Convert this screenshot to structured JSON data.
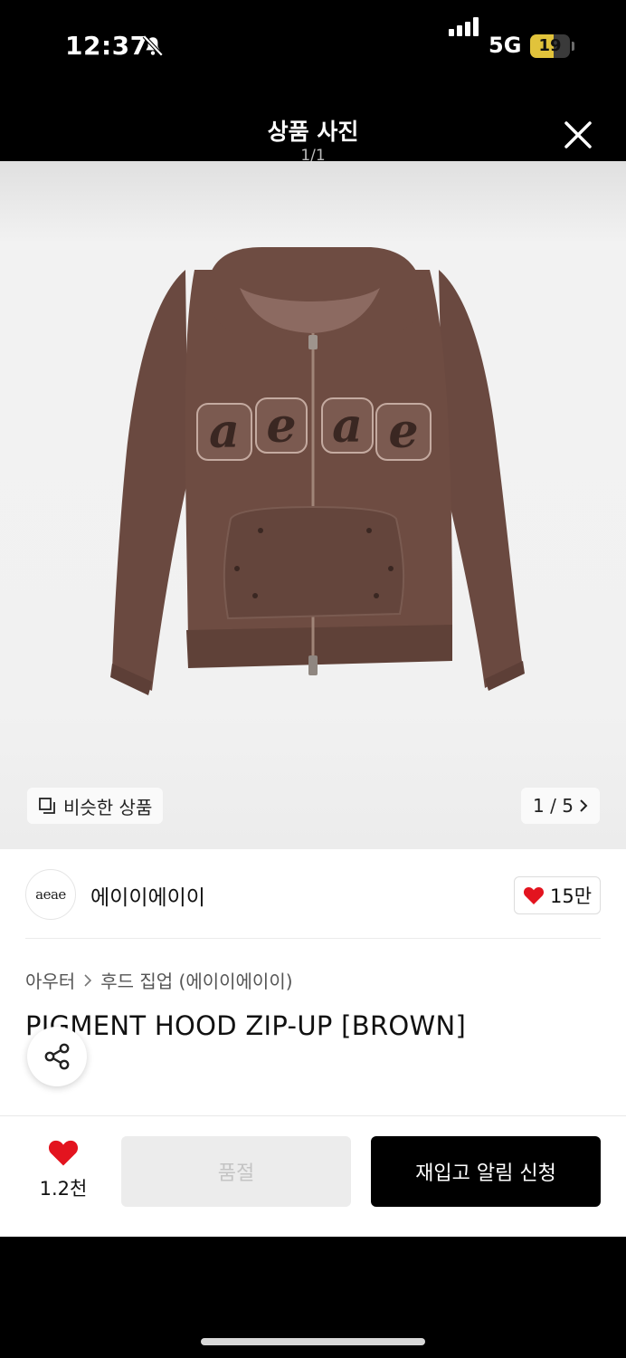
{
  "status_bar": {
    "time": "12:37",
    "network": "5G",
    "battery": "19",
    "bell_icon": "bell-slash-icon"
  },
  "viewer": {
    "title": "상품 사진",
    "counter": "1/1",
    "close_icon": "close-icon"
  },
  "image": {
    "similar_label": "비슷한 상품",
    "pager": "1 / 5",
    "chest_letters": [
      "a",
      "e",
      "a",
      "e"
    ]
  },
  "brand": {
    "logo_text": "aeae",
    "name": "에이이에이이",
    "likes": "15만"
  },
  "breadcrumb": {
    "category": "아우터",
    "subcategory": "후드 집업 (에이이에이이)"
  },
  "product": {
    "title": "PIGMENT HOOD ZIP-UP [BROWN]"
  },
  "bottom_bar": {
    "wish_count": "1.2천",
    "soldout_label": "품절",
    "restock_label": "재입고 알림 신청"
  },
  "colors": {
    "hoodie_brown": "#6e4c42",
    "heart_red": "#e3141f",
    "primary_button": "#000000"
  }
}
